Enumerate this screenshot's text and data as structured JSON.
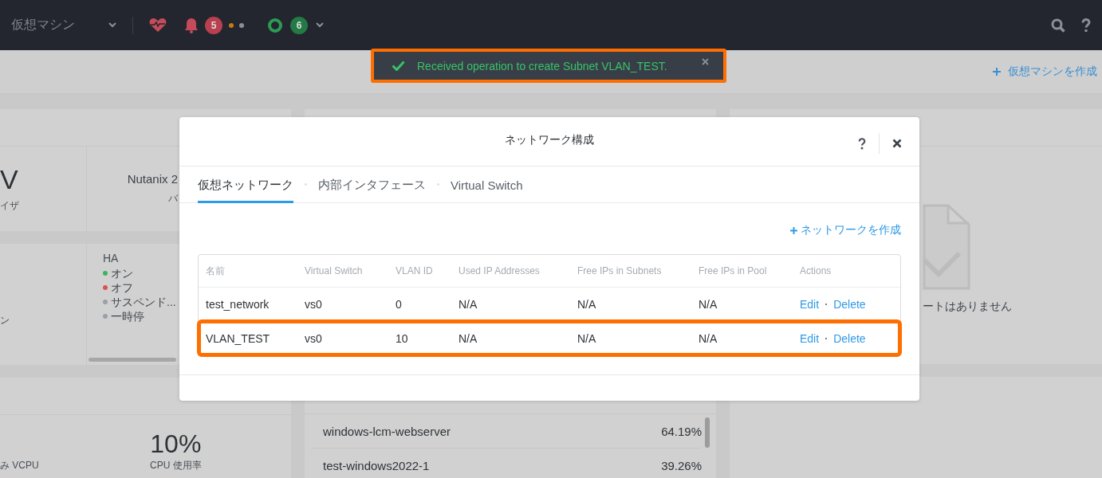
{
  "topbar": {
    "section": "仮想マシン",
    "alert_count": "5",
    "task_count": "6"
  },
  "subbar": {
    "create_vm": "仮想マシンを作成"
  },
  "toast": {
    "kind": "success",
    "message": "Received operation to create Subnet VLAN_TEST."
  },
  "dashboard": {
    "summary": {
      "hypervisor_value": "V",
      "hypervisor_label": "イザ",
      "version_value": "Nutanix 2",
      "version_label": "バ"
    },
    "vm_summary": {
      "left_label": "ン",
      "ha_title": "HA",
      "ha_states": [
        {
          "label": "オン",
          "color": "#3cb55a"
        },
        {
          "label": "オフ",
          "color": "#d9534f"
        },
        {
          "label": "サスペンド...",
          "color": "#9aa0a8"
        },
        {
          "label": "一時停",
          "color": "#9aa0a8"
        }
      ]
    },
    "cpu": {
      "left_label": "み VCPU",
      "value": "10%",
      "label": "CPU 使用率"
    },
    "top_vms": [
      {
        "name": "windows-lcm-webserver",
        "value": "64.19%"
      },
      {
        "name": "test-windows2022-1",
        "value": "39.26%"
      }
    ],
    "alerts": {
      "empty_text": "ートはありません"
    }
  },
  "dialog": {
    "title": "ネットワーク構成",
    "tabs": [
      {
        "label": "仮想ネットワーク",
        "selected": true
      },
      {
        "label": "内部インタフェース",
        "selected": false
      },
      {
        "label": "Virtual Switch",
        "selected": false
      }
    ],
    "create_link": "ネットワークを作成",
    "table": {
      "columns": [
        "名前",
        "Virtual Switch",
        "VLAN ID",
        "Used IP Addresses",
        "Free IPs in Subnets",
        "Free IPs in Pool",
        "Actions"
      ],
      "rows": [
        {
          "cells": [
            "test_network",
            "vs0",
            "0",
            "N/A",
            "N/A",
            "N/A"
          ],
          "actions": [
            "Edit",
            "Delete"
          ],
          "highlighted": false
        },
        {
          "cells": [
            "VLAN_TEST",
            "vs0",
            "10",
            "N/A",
            "N/A",
            "N/A"
          ],
          "actions": [
            "Edit",
            "Delete"
          ],
          "highlighted": true
        }
      ]
    }
  }
}
